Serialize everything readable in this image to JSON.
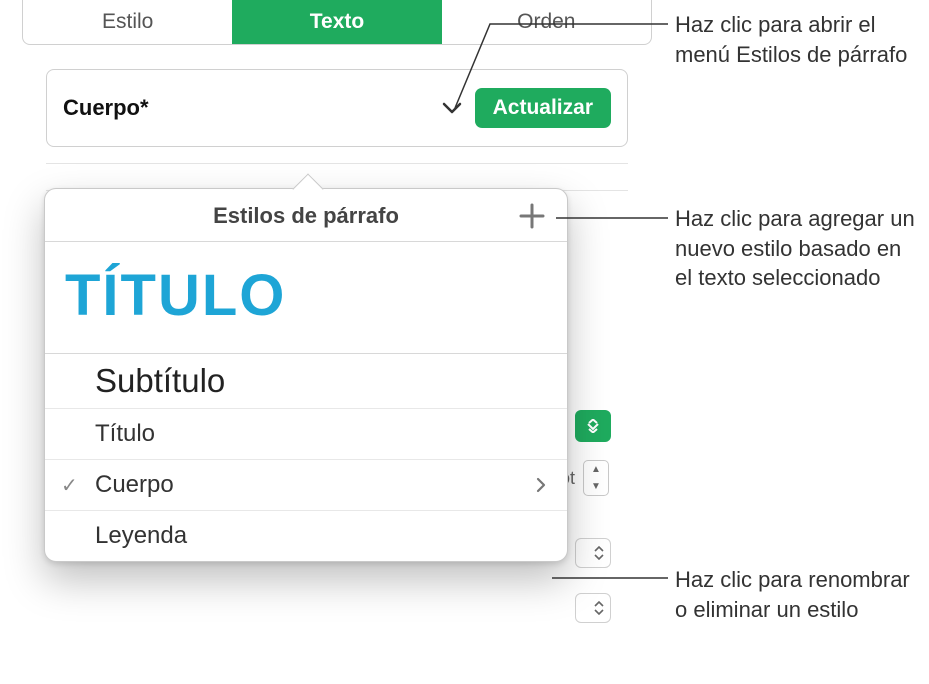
{
  "tabs": {
    "style": "Estilo",
    "text": "Texto",
    "order": "Orden"
  },
  "styleRow": {
    "name": "Cuerpo*",
    "updateLabel": "Actualizar"
  },
  "popover": {
    "title": "Estilos de párrafo",
    "preview": "TÍTULO",
    "items": {
      "subtitle": "Subtítulo",
      "title": "Título",
      "body": "Cuerpo",
      "caption": "Leyenda"
    }
  },
  "bg": {
    "fontSuffix": "ot"
  },
  "callouts": {
    "openMenu": "Haz clic para abrir el menú Estilos de párrafo",
    "addStyle": "Haz clic para agregar un nuevo estilo basado en el texto seleccionado",
    "renameDelete": "Haz clic para renombrar o eliminar un estilo"
  }
}
